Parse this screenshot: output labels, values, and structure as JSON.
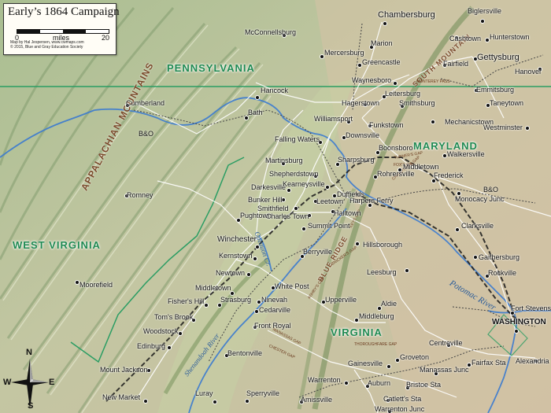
{
  "title_box": {
    "title": "Early’s 1864 Campaign",
    "scale_left": "0",
    "scale_unit": "miles",
    "scale_right": "20",
    "credit_line_1": "Map by Hal Jespersen, www.cwmaps.com",
    "credit_line_2": "© 2015, Blue and Gray Education Society"
  },
  "compass": {
    "n": "N",
    "s": "S",
    "e": "E",
    "w": "W"
  },
  "states": {
    "pennsylvania": "PENNSYLVANIA",
    "maryland": "MARYLAND",
    "west_virginia": "WEST VIRGINIA",
    "virginia": "VIRGINIA"
  },
  "features": {
    "appalachian": "APPALACHIAN MOUNTAINS",
    "blue_ridge": "BLUE RIDGE",
    "south_mountain": "SOUTH MOUNTAIN"
  },
  "rivers": {
    "potomac": "Potomac River",
    "shenandoah": "Shenandoah River",
    "opequon": "Opequon Cr."
  },
  "railroad": {
    "bo_west": "B&O",
    "bo_east": "B&O"
  },
  "gaps": {
    "monterey": "MONTEREY PASS",
    "turners": "TURNER'S GAP",
    "cramptons": "CRAMPTON'S GAP",
    "snickers": "SNICKER'S GAP",
    "ashbys": "ASHBY'S GAP",
    "manassas": "MANASSAS GAP",
    "chesters": "CHESTER GAP",
    "thoroughfare": "THOROUGHFARE GAP",
    "keys": "KEYS GAP",
    "fox": "FOX'S GAP"
  },
  "towns": [
    {
      "name": "Chambersburg"
    },
    {
      "name": "Biglersville"
    },
    {
      "name": "McConnellsburg"
    },
    {
      "name": "Marion"
    },
    {
      "name": "Cashtown"
    },
    {
      "name": "Hunterstown"
    },
    {
      "name": "Mercersburg"
    },
    {
      "name": "Greencastle"
    },
    {
      "name": "Fairfield"
    },
    {
      "name": "Gettysburg"
    },
    {
      "name": "Hanover"
    },
    {
      "name": "Waynesboro"
    },
    {
      "name": "Emmitsburg"
    },
    {
      "name": "Hancock"
    },
    {
      "name": "Leitersburg"
    },
    {
      "name": "Hagerstown"
    },
    {
      "name": "Smithsburg"
    },
    {
      "name": "Taneytown"
    },
    {
      "name": "Cumberland"
    },
    {
      "name": "Bath"
    },
    {
      "name": "Williamsport"
    },
    {
      "name": "Mechanicstown"
    },
    {
      "name": "Funkstown"
    },
    {
      "name": "Westminster"
    },
    {
      "name": "Falling Waters"
    },
    {
      "name": "Downsville"
    },
    {
      "name": "Boonsboro"
    },
    {
      "name": "Martinsburg"
    },
    {
      "name": "Sharpsburg"
    },
    {
      "name": "Walkersville"
    },
    {
      "name": "Middletown"
    },
    {
      "name": "Shepherdstown"
    },
    {
      "name": "Rohrersville"
    },
    {
      "name": "Frederick"
    },
    {
      "name": "Darkesville"
    },
    {
      "name": "Kearneysville"
    },
    {
      "name": "Romney"
    },
    {
      "name": "Bunker Hill"
    },
    {
      "name": "Duffields"
    },
    {
      "name": "Smithfield"
    },
    {
      "name": "Leetown"
    },
    {
      "name": "Harpers Ferry"
    },
    {
      "name": "Monocacy Junc"
    },
    {
      "name": "Charles Town"
    },
    {
      "name": "Halltown"
    },
    {
      "name": "Pughtown"
    },
    {
      "name": "Summit Point"
    },
    {
      "name": "Clarksville"
    },
    {
      "name": "Winchester"
    },
    {
      "name": "Hillsborough"
    },
    {
      "name": "Berryville"
    },
    {
      "name": "Kernstown"
    },
    {
      "name": "Gaithersburg"
    },
    {
      "name": "Newtown"
    },
    {
      "name": "Leesburg"
    },
    {
      "name": "Rockville"
    },
    {
      "name": "Moorefield"
    },
    {
      "name": "White Post"
    },
    {
      "name": "Middletown"
    },
    {
      "name": "Ninevah"
    },
    {
      "name": "Upperville"
    },
    {
      "name": "Fisher's Hill"
    },
    {
      "name": "Strasburg"
    },
    {
      "name": "Aldie"
    },
    {
      "name": "Cedarville"
    },
    {
      "name": "Fort Stevens"
    },
    {
      "name": "Middleburg"
    },
    {
      "name": "Tom's Brook"
    },
    {
      "name": "Woodstock"
    },
    {
      "name": "Front Royal"
    },
    {
      "name": "WASHINGTON"
    },
    {
      "name": "Edinburg"
    },
    {
      "name": "Centreville"
    },
    {
      "name": "Bentonville"
    },
    {
      "name": "Groveton"
    },
    {
      "name": "Gainesville"
    },
    {
      "name": "Alexandria"
    },
    {
      "name": "Mount Jackson"
    },
    {
      "name": "Fairfax Sta"
    },
    {
      "name": "Manassas Junc"
    },
    {
      "name": "Warrenton"
    },
    {
      "name": "Auburn"
    },
    {
      "name": "Bristoe Sta"
    },
    {
      "name": "New Market"
    },
    {
      "name": "Luray"
    },
    {
      "name": "Sperryville"
    },
    {
      "name": "Amissville"
    },
    {
      "name": "Catlett's Sta"
    },
    {
      "name": "Warrenton Junc"
    }
  ]
}
